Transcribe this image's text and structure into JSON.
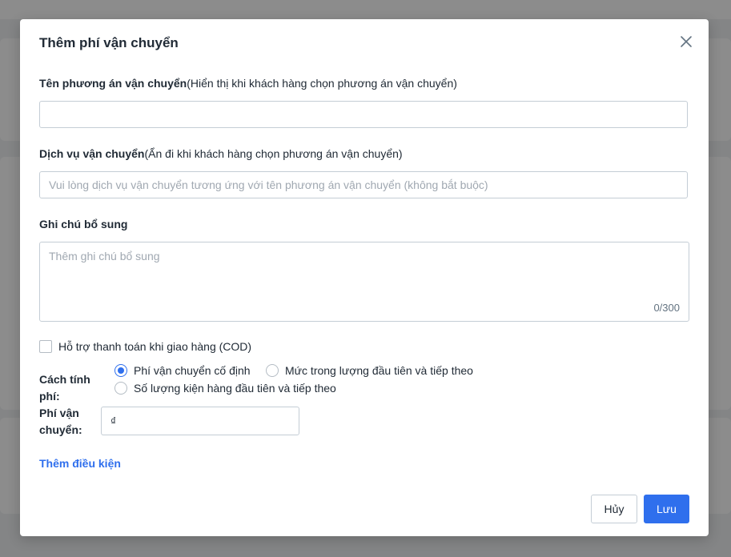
{
  "modal": {
    "title": "Thêm phí vận chuyển",
    "shipping_name": {
      "label_bold": "Tên phương án vận chuyển",
      "label_hint": "(Hiển thị khi khách hàng chọn phương án vận chuyển)",
      "value": "",
      "placeholder": ""
    },
    "shipping_service": {
      "label_bold": "Dịch vụ vận chuyển",
      "label_hint": "(Ẩn đi khi khách hàng chọn phương án vận chuyển)",
      "value": "",
      "placeholder": "Vui lòng dịch vụ vận chuyển tương ứng với tên phương án vận chuyển (không bắt buộc)"
    },
    "note": {
      "label": "Ghi chú bổ sung",
      "value": "",
      "placeholder": "Thêm ghi chú bổ sung",
      "char_count": "0/300"
    },
    "cod": {
      "label": "Hỗ trợ thanh toán khi giao hàng (COD)",
      "checked": false
    },
    "calc_method": {
      "label": "Cách tính phí:",
      "options": [
        {
          "label": "Phí vận chuyển cố định",
          "selected": true
        },
        {
          "label": "Mức trong lượng đầu tiên và tiếp theo",
          "selected": false
        },
        {
          "label": "Số lượng kiện hàng đầu tiên và tiếp theo",
          "selected": false
        }
      ]
    },
    "fee": {
      "label": "Phí vận chuyển:",
      "currency": "₫",
      "value": ""
    },
    "add_condition_label": "Thêm điều kiện",
    "buttons": {
      "cancel": "Hủy",
      "save": "Lưu"
    }
  },
  "icons": {
    "close": "close-icon"
  },
  "colors": {
    "accent": "#2f6fed",
    "overlay": "rgba(0,0,0,0.45)"
  }
}
